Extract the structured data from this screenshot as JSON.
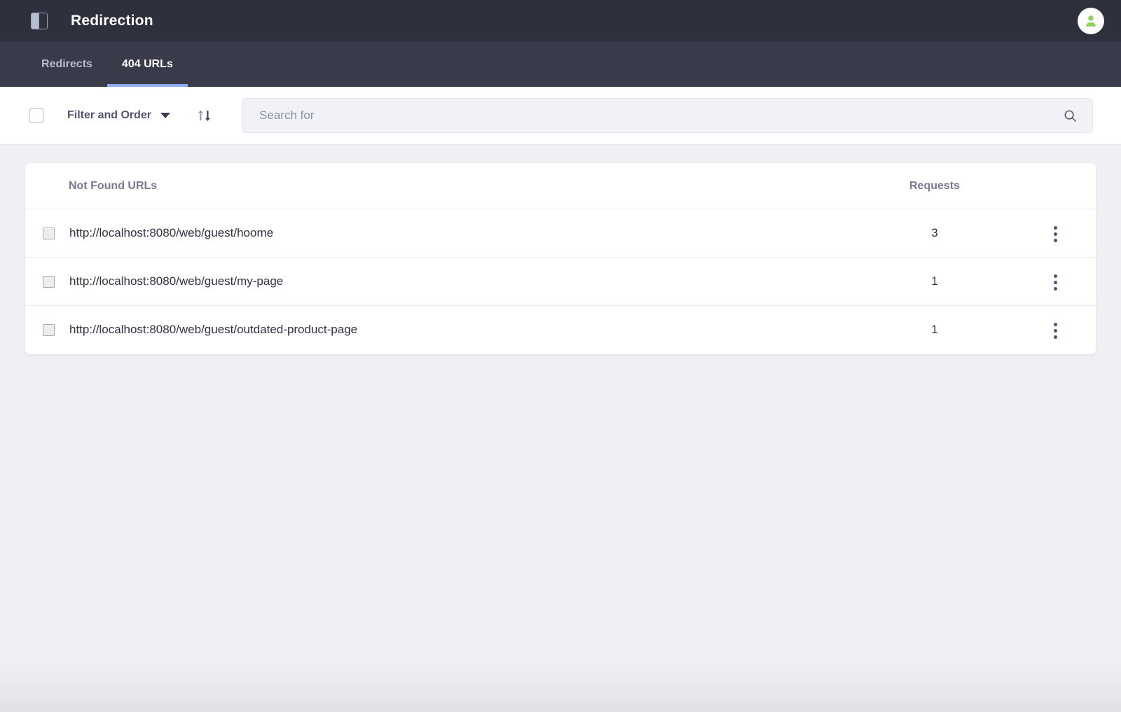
{
  "header": {
    "title": "Redirection",
    "panel_toggle_icon": "sidebar-toggle-icon",
    "avatar_icon": "user-avatar-icon",
    "bg_color": "#2f303d"
  },
  "tabs": {
    "active_index": 1,
    "indicator_color": "#89aef5",
    "bg_color": "#393a4a",
    "items": [
      {
        "label": "Redirects"
      },
      {
        "label": "404 URLs"
      }
    ]
  },
  "toolbar": {
    "select_all_checkbox": "",
    "filter_label": "Filter and Order",
    "caret_icon": "chevron-down-icon",
    "sort_icon": "sort-arrows-icon",
    "search": {
      "value": "",
      "placeholder": "Search for",
      "icon": "search-icon"
    }
  },
  "table": {
    "columns": {
      "url": "Not Found URLs",
      "requests": "Requests"
    },
    "rows": [
      {
        "url": "http://localhost:8080/web/guest/hoome",
        "requests": "3",
        "menu_icon": "kebab-menu-icon"
      },
      {
        "url": "http://localhost:8080/web/guest/my-page",
        "requests": "1",
        "menu_icon": "kebab-menu-icon"
      },
      {
        "url": "http://localhost:8080/web/guest/outdated-product-page",
        "requests": "1",
        "menu_icon": "kebab-menu-icon"
      }
    ]
  }
}
